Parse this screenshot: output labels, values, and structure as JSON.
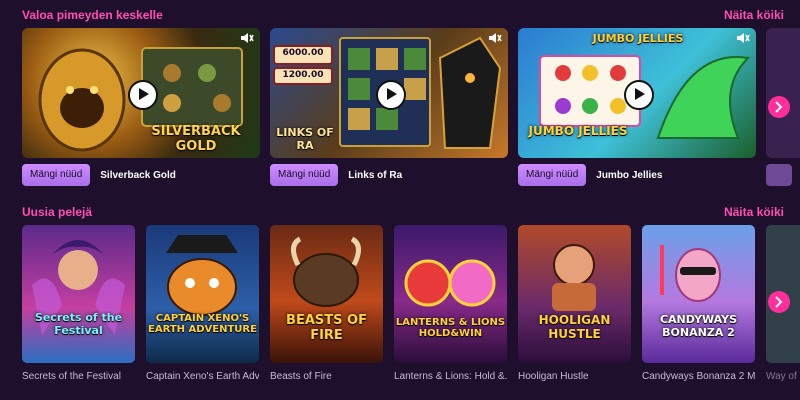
{
  "sections": {
    "featured": {
      "title": "Valoa pimeyden keskelle",
      "see_all": "Näita köiki",
      "play_label": "Mängi nüüd",
      "games": [
        {
          "name": "Silverback Gold",
          "logo": "SILVERBACK GOLD",
          "color": "#c78a1f"
        },
        {
          "name": "Links of Ra",
          "logo": "LINKS OF RA",
          "color": "#2a4a88",
          "readouts": [
            "6000.00",
            "1200.00"
          ]
        },
        {
          "name": "Jumbo Jellies",
          "logo": "JUMBO JELLIES",
          "color": "#2b7bd1"
        }
      ]
    },
    "new_games": {
      "title": "Uusia pelejä",
      "see_all": "Näita köiki",
      "games": [
        {
          "name": "Secrets of the Festival",
          "logo": "Secrets of the Festival"
        },
        {
          "name": "Captain Xeno's Earth Adv...",
          "logo": "CAPTAIN XENO'S EARTH ADVENTURE"
        },
        {
          "name": "Beasts of Fire",
          "logo": "BEASTS OF FIRE"
        },
        {
          "name": "Lanterns & Lions: Hold &...",
          "logo": "LANTERNS & LIONS HOLD&WIN"
        },
        {
          "name": "Hooligan Hustle",
          "logo": "HOOLIGAN HUSTLE"
        },
        {
          "name": "Candyways Bonanza 2 M...",
          "logo": "CANDYWAYS BONANZA 2"
        },
        {
          "name": "Way of R..."
        }
      ]
    }
  },
  "icons": {
    "mute": "mute-icon",
    "play": "play-icon",
    "arrow": "chevron-right-icon"
  },
  "colors": {
    "accent": "#ff4fb2",
    "arrow": "#ff2e9a",
    "background": "#1e0f2c",
    "play_button": "#b77cf0"
  }
}
